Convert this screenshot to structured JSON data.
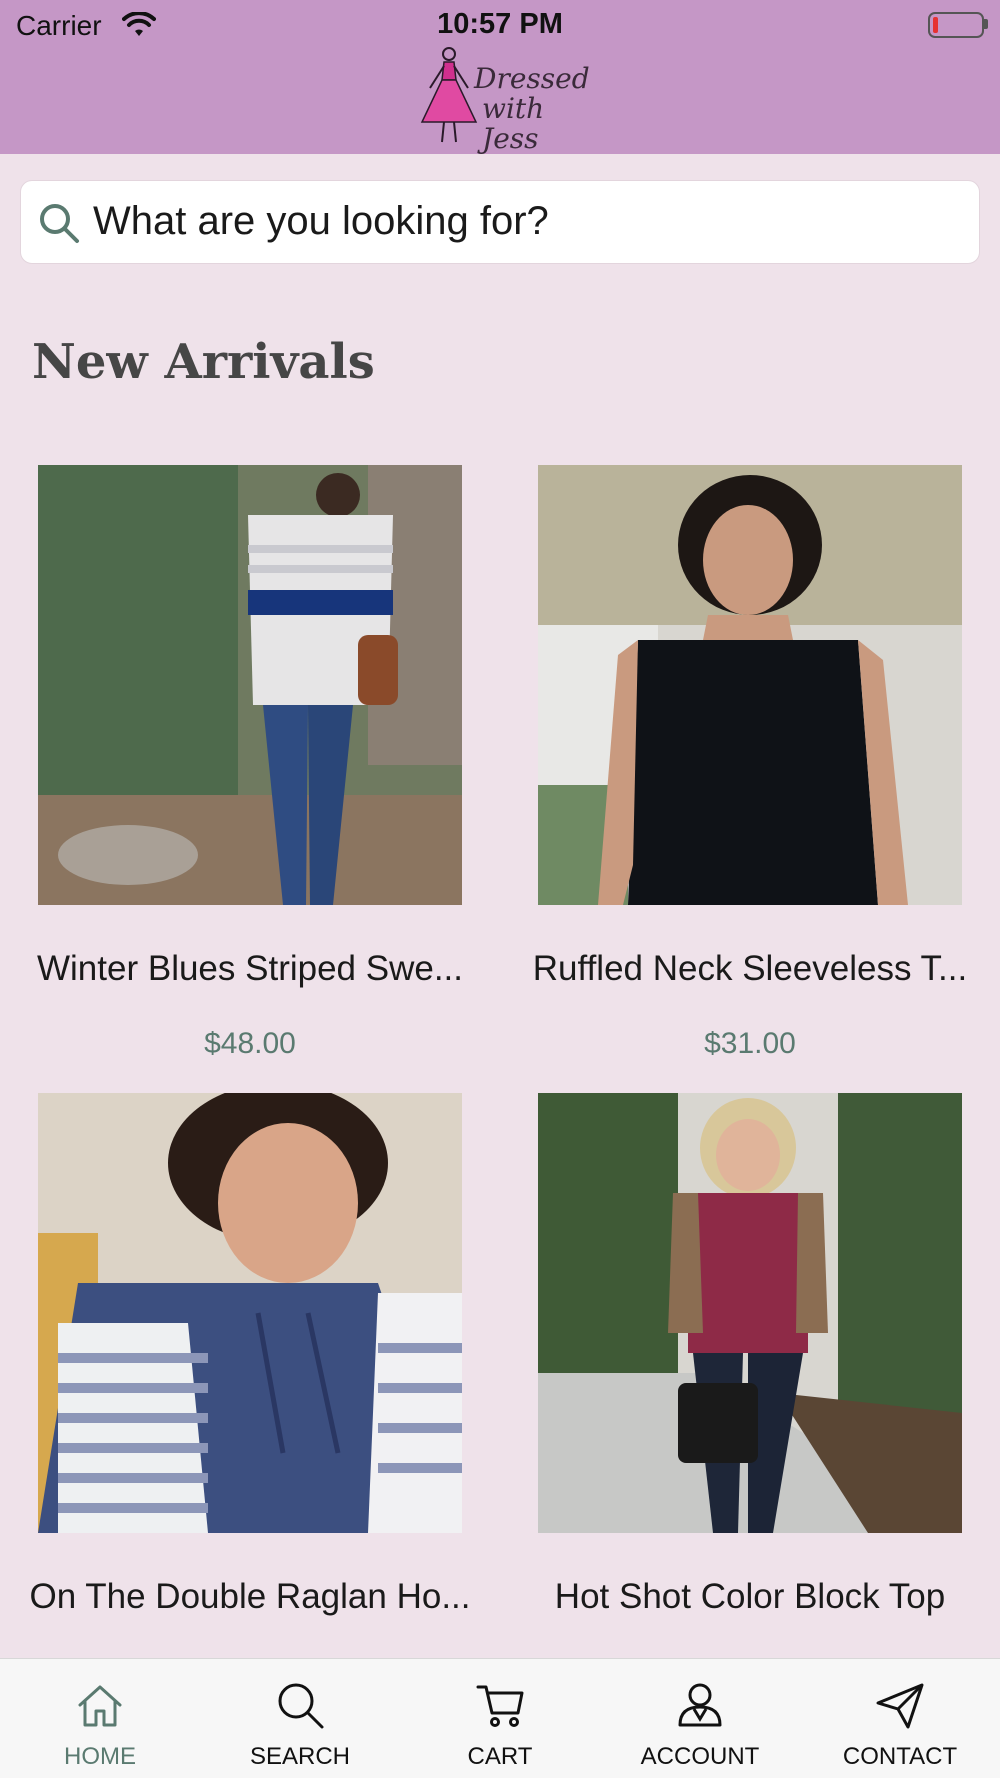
{
  "status_bar": {
    "carrier": "Carrier",
    "time": "10:57 PM",
    "battery_color": "#e63232"
  },
  "header": {
    "background": "#c597c6",
    "logo_text_line1": "Dressed",
    "logo_text_line2": "with Jess"
  },
  "search": {
    "placeholder": "What are you looking for?",
    "icon": "search-icon"
  },
  "section": {
    "title": "New Arrivals"
  },
  "products": [
    {
      "name": "Winter Blues Striped Swe...",
      "price": "$48.00"
    },
    {
      "name": "Ruffled Neck Sleeveless T...",
      "price": "$31.00"
    },
    {
      "name": "On The Double Raglan Ho...",
      "price": ""
    },
    {
      "name": "Hot Shot Color Block Top",
      "price": ""
    }
  ],
  "tabbar": {
    "active": "HOME",
    "active_color": "#5a7a70",
    "tabs": [
      {
        "label": "HOME",
        "icon": "home-icon"
      },
      {
        "label": "SEARCH",
        "icon": "search-icon"
      },
      {
        "label": "CART",
        "icon": "cart-icon"
      },
      {
        "label": "ACCOUNT",
        "icon": "account-icon"
      },
      {
        "label": "CONTACT",
        "icon": "send-icon"
      }
    ]
  }
}
